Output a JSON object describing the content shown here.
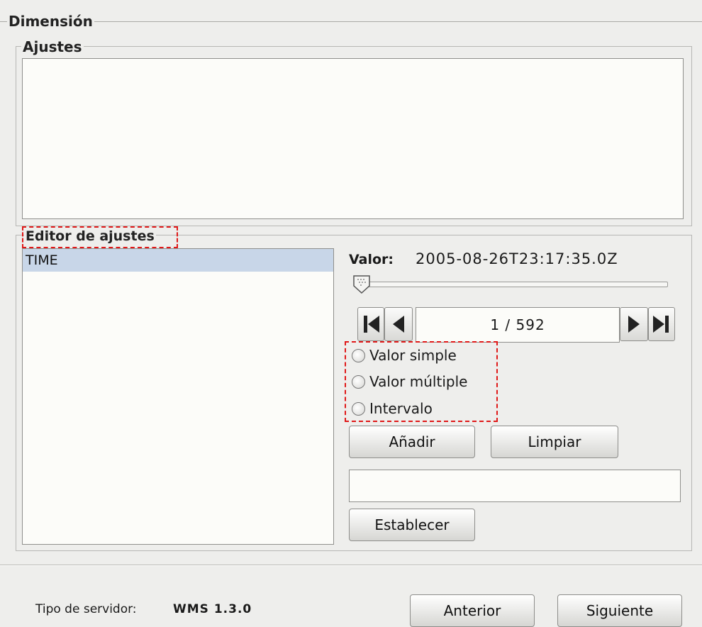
{
  "dimension": {
    "title": "Dimensión"
  },
  "settings": {
    "title": "Ajustes"
  },
  "editor": {
    "title": "Editor de ajustes",
    "list_items": [
      "TIME"
    ],
    "valor_label": "Valor:",
    "valor_value": "2005-08-26T23:17:35.0Z",
    "slider_position": 0,
    "page_indicator": "1 / 592",
    "radio_options": [
      "Valor simple",
      "Valor múltiple",
      "Intervalo"
    ],
    "add_label": "Añadir",
    "clear_label": "Limpiar",
    "expression_value": "",
    "set_label": "Establecer"
  },
  "footer": {
    "server_type_label": "Tipo de servidor:",
    "server_type_value": "WMS 1.3.0",
    "previous_label": "Anterior",
    "next_label": "Siguiente"
  },
  "colors": {
    "selection": "#c8d6e8",
    "highlight_dash": "#e01818"
  }
}
